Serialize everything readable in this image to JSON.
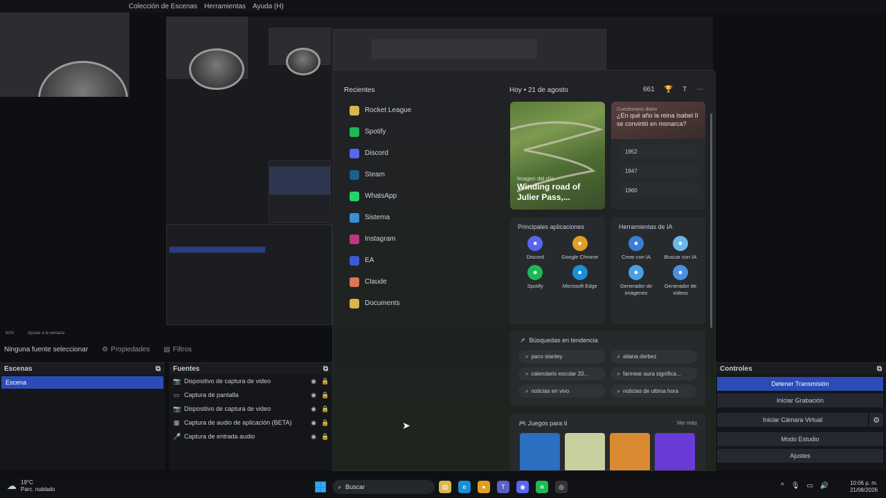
{
  "menubar": {
    "items": [
      "Colección de Escenas",
      "Herramientas",
      "Ayuda (H)"
    ]
  },
  "statusbar": {
    "zoom": "61%",
    "fit": "Ajustar a la ventana"
  },
  "source_toolbar": {
    "no_source": "Ninguna fuente seleccionar",
    "properties": "Propiedades",
    "filters": "Filtros"
  },
  "scenes": {
    "title": "Escenas",
    "items": [
      "Escena"
    ]
  },
  "sources": {
    "title": "Fuentes",
    "items": [
      {
        "label": "Dispositivo de captura de video",
        "icon": "camera-icon"
      },
      {
        "label": "Captura de pantalla",
        "icon": "monitor-icon"
      },
      {
        "label": "Dispositivo de captura de video",
        "icon": "camera-icon"
      },
      {
        "label": "Captura de audio de aplicación (BETA)",
        "icon": "window-icon"
      },
      {
        "label": "Captura de entrada audio",
        "icon": "mic-icon"
      }
    ]
  },
  "controls": {
    "title": "Controles",
    "stop_stream": "Detener Transmisión",
    "start_record": "Iniciar Grabación",
    "virtual_cam": "Iniciar Cámara Virtual",
    "studio": "Modo Estudio",
    "settings": "Ajustes"
  },
  "start_menu": {
    "recent_title": "Recientes",
    "recent": [
      {
        "label": "Rocket League",
        "color": "#d9b74a"
      },
      {
        "label": "Spotify",
        "color": "#1db954"
      },
      {
        "label": "Discord",
        "color": "#5865f2"
      },
      {
        "label": "Steam",
        "color": "#1b5f8f"
      },
      {
        "label": "WhatsApp",
        "color": "#25d366"
      },
      {
        "label": "Sistema",
        "color": "#3a8fd6"
      },
      {
        "label": "Instagram",
        "color": "#c13584"
      },
      {
        "label": "EA",
        "color": "#3b5bd6"
      },
      {
        "label": "Claude",
        "color": "#d97757"
      },
      {
        "label": "Documents",
        "color": "#d9b74a"
      }
    ],
    "today": "Hoy",
    "date": "21 de agosto",
    "points": "661",
    "avatar": "T",
    "image_of_day": {
      "small": "Imagen del día",
      "title": "Winding road of Julier Pass,..."
    },
    "quiz": {
      "small": "Cuestionario diario",
      "question": "¿En qué año la reina Isabel II se convirtió en monarca?",
      "options": [
        "1952",
        "1947",
        "1960"
      ]
    },
    "top_apps": {
      "title": "Principales aplicaciones",
      "items": [
        {
          "label": "Discord",
          "color": "#5865f2",
          "icon": "discord-icon"
        },
        {
          "label": "Google Chrome",
          "color": "#e0a020",
          "icon": "chrome-icon"
        },
        {
          "label": "Spotify",
          "color": "#1db954",
          "icon": "spotify-icon"
        },
        {
          "label": "Microsoft Edge",
          "color": "#1a8fd6",
          "icon": "edge-icon"
        }
      ]
    },
    "ai_tools": {
      "title": "Herramientas de IA",
      "items": [
        {
          "label": "Crear con IA",
          "color": "#3a7fd6",
          "icon": "create-ai-icon"
        },
        {
          "label": "Buscar con IA",
          "color": "#6ab7e8",
          "icon": "search-ai-icon"
        },
        {
          "label": "Generador de imágenes",
          "color": "#4aa0e0",
          "icon": "image-gen-icon"
        },
        {
          "label": "Generador de videos",
          "color": "#4a90e0",
          "icon": "video-gen-icon"
        }
      ]
    },
    "trending": {
      "title": "Búsquedas en tendencia",
      "items": [
        "paco stanley",
        "aitana derbez",
        "calendario escolar 20...",
        "farmear aura significa...",
        "noticias en vivo",
        "noticias de ultima hora"
      ]
    },
    "games": {
      "title": "Juegos para ti",
      "more": "Ver más",
      "tiles": [
        "#2a6fc0",
        "#c8d0a0",
        "#d98a30",
        "#6a3ad6"
      ]
    }
  },
  "taskbar": {
    "weather_temp": "19°C",
    "weather_desc": "Parc. nublado",
    "search_placeholder": "Buscar",
    "time": "10:06 p. m.",
    "date": "21/08/2026"
  }
}
